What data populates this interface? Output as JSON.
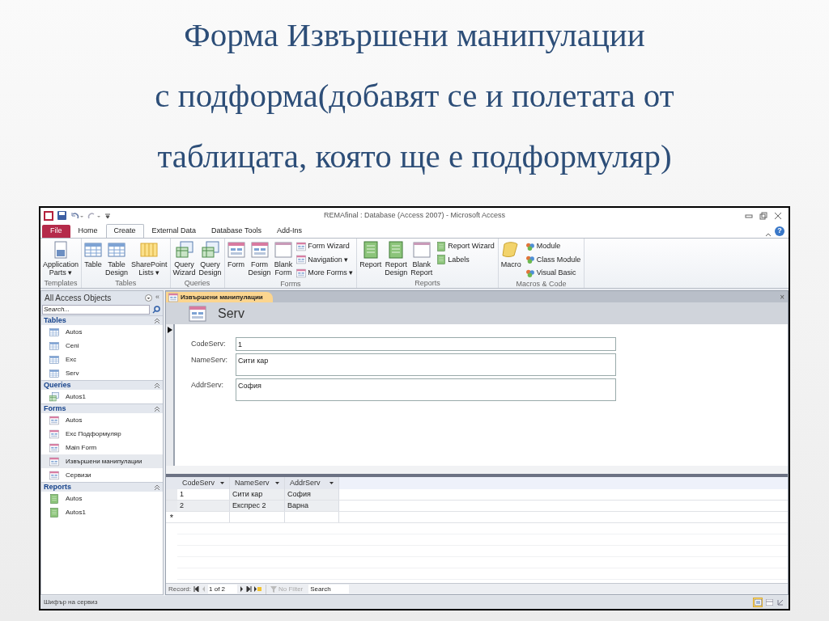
{
  "slide": {
    "title_lines": [
      "Форма Извършени манипулации",
      "с подформа(добавят се и полетата от",
      "таблицата, която ще е подформуляр)"
    ]
  },
  "window": {
    "title": "REMAfinal : Database (Access 2007)  -  Microsoft Access",
    "help": "?"
  },
  "ribbon": {
    "tabs": [
      {
        "label": "File",
        "kind": "file",
        "selected": false
      },
      {
        "label": "Home",
        "kind": "tab",
        "selected": false
      },
      {
        "label": "Create",
        "kind": "tab",
        "selected": true
      },
      {
        "label": "External Data",
        "kind": "tab",
        "selected": false
      },
      {
        "label": "Database Tools",
        "kind": "tab",
        "selected": false
      },
      {
        "label": "Add-Ins",
        "kind": "tab",
        "selected": false
      }
    ],
    "groups": [
      {
        "label": "Templates",
        "large": [
          {
            "label": "Application\nParts ▾",
            "kind": "doc"
          }
        ]
      },
      {
        "label": "Tables",
        "large": [
          {
            "label": "Table",
            "kind": "table"
          },
          {
            "label": "Table\nDesign",
            "kind": "table"
          },
          {
            "label": "SharePoint\nLists ▾",
            "kind": "list"
          }
        ]
      },
      {
        "label": "Queries",
        "large": [
          {
            "label": "Query\nWizard",
            "kind": "query"
          },
          {
            "label": "Query\nDesign",
            "kind": "query"
          }
        ]
      },
      {
        "label": "Forms",
        "large": [
          {
            "label": "Form",
            "kind": "form"
          },
          {
            "label": "Form\nDesign",
            "kind": "form"
          },
          {
            "label": "Blank\nForm",
            "kind": "blank"
          }
        ],
        "small": [
          {
            "label": "Form Wizard",
            "kind": "form"
          },
          {
            "label": "Navigation ▾",
            "kind": "form"
          },
          {
            "label": "More Forms ▾",
            "kind": "form"
          }
        ]
      },
      {
        "label": "Reports",
        "large": [
          {
            "label": "Report",
            "kind": "report"
          },
          {
            "label": "Report\nDesign",
            "kind": "report"
          },
          {
            "label": "Blank\nReport",
            "kind": "blank"
          }
        ],
        "small": [
          {
            "label": "Report Wizard",
            "kind": "report"
          },
          {
            "label": "Labels",
            "kind": "report"
          }
        ]
      },
      {
        "label": "Macros & Code",
        "large": [
          {
            "label": "Macro",
            "kind": "macro"
          }
        ],
        "small": [
          {
            "label": "Module",
            "kind": "module"
          },
          {
            "label": "Class Module",
            "kind": "module"
          },
          {
            "label": "Visual Basic",
            "kind": "module"
          }
        ]
      }
    ]
  },
  "nav_pane": {
    "title": "All Access Objects",
    "collapse": "«",
    "search": {
      "placeholder": "Search..."
    },
    "sections": [
      {
        "label": "Tables",
        "kind": "table",
        "items": [
          {
            "label": "Autos",
            "selected": false
          },
          {
            "label": "Ceni",
            "selected": false
          },
          {
            "label": "Exc",
            "selected": false
          },
          {
            "label": "Serv",
            "selected": false
          }
        ]
      },
      {
        "label": "Queries",
        "kind": "query",
        "items": [
          {
            "label": "Autos1",
            "selected": false
          }
        ]
      },
      {
        "label": "Forms",
        "kind": "form",
        "items": [
          {
            "label": "Autos",
            "selected": false
          },
          {
            "label": "Exc Подформуляр",
            "selected": false
          },
          {
            "label": "Main Form",
            "selected": false
          },
          {
            "label": "Извършени манипулации",
            "selected": true
          },
          {
            "label": "Сервизи",
            "selected": false
          }
        ]
      },
      {
        "label": "Reports",
        "kind": "report",
        "items": [
          {
            "label": "Autos",
            "selected": false
          },
          {
            "label": "Autos1",
            "selected": false
          }
        ]
      }
    ]
  },
  "document": {
    "tab": {
      "label": "Извършени манипулации",
      "selected": true
    },
    "close": "×",
    "form_title": "Serv",
    "fields": [
      {
        "label": "CodeServ:",
        "value": "1",
        "kind": "single"
      },
      {
        "label": "NameServ:",
        "value": "Сити кар",
        "kind": "multi"
      },
      {
        "label": "AddrServ:",
        "value": "София",
        "kind": "multi"
      }
    ],
    "subform": {
      "columns": [
        "CodeServ",
        "NameServ",
        "AddrServ"
      ],
      "rows": [
        {
          "cells": [
            "1",
            "Сити кар",
            "София"
          ],
          "selected": true
        },
        {
          "cells": [
            "2",
            "Експрес 2",
            "Варна"
          ],
          "selected": false
        }
      ],
      "new_row_marker": "*",
      "record_nav": {
        "label": "Record:",
        "position": "1 of 2",
        "filter": "No Filter",
        "search": "Search"
      }
    }
  },
  "status_bar": {
    "text": "Шифър на сервиз",
    "views": [
      {
        "kind": "form",
        "selected": true
      },
      {
        "kind": "layout",
        "selected": false
      },
      {
        "kind": "design",
        "selected": false
      }
    ]
  }
}
